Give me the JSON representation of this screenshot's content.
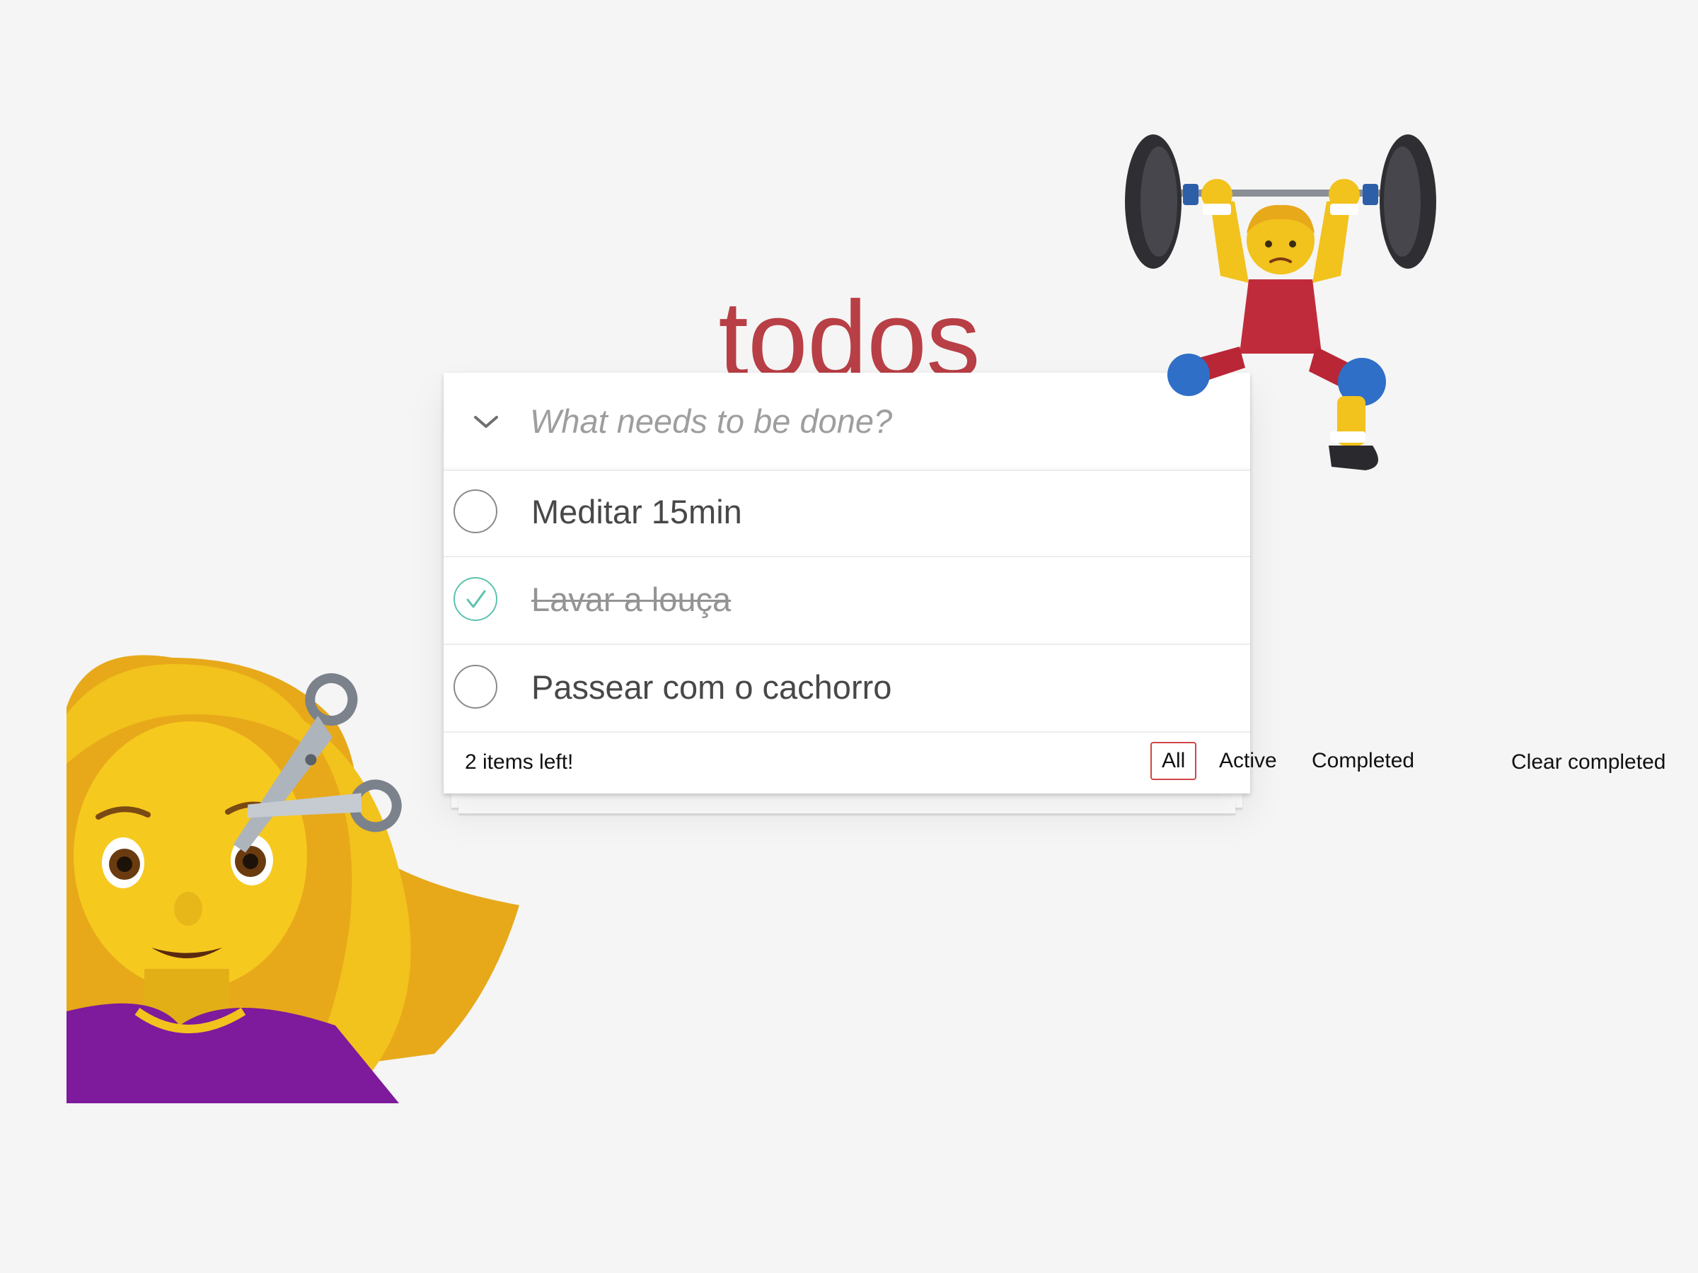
{
  "app": {
    "title": "todos"
  },
  "new_todo": {
    "placeholder": "What needs to be done?",
    "toggle_icon": "chevron-down-icon"
  },
  "todos": [
    {
      "label": "Meditar 15min",
      "completed": false
    },
    {
      "label": "Lavar a louça",
      "completed": true
    },
    {
      "label": "Passear com o cachorro",
      "completed": false
    }
  ],
  "footer": {
    "count": "2 items left!",
    "filters": [
      "All",
      "Active",
      "Completed"
    ],
    "selected_filter": "All",
    "clear": "Clear completed"
  },
  "decorations": {
    "left": "woman-getting-haircut-emoji",
    "right": "person-lifting-weights-emoji"
  },
  "colors": {
    "title": "#b83f45",
    "selected_filter_border": "#ce4646",
    "check_green": "#5dc2af",
    "background": "#f5f5f5"
  }
}
